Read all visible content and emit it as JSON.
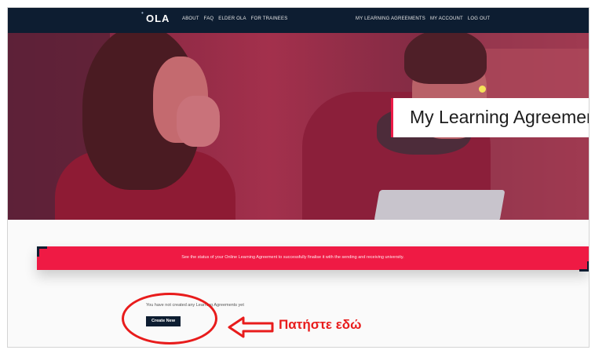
{
  "nav": {
    "logo": "OLA",
    "links_left": [
      "ABOUT",
      "FAQ",
      "ELDER OLA",
      "FOR TRAINEES"
    ],
    "links_right": [
      "MY LEARNING AGREEMENTS",
      "MY ACCOUNT",
      "LOG OUT"
    ]
  },
  "hero": {
    "title": "My Learning Agreements"
  },
  "banner": {
    "text": "See the status of your Online Learning Agreement to successfully finalise it with the sending and receiving university."
  },
  "content": {
    "empty_message": "You have not created any Learning Agreements yet",
    "create_button": "Create New"
  },
  "annotation": {
    "text": "Πατήστε εδώ"
  },
  "colors": {
    "nav_bg": "#0d1d31",
    "accent": "#ef1a44",
    "annotation": "#e81c1c"
  }
}
